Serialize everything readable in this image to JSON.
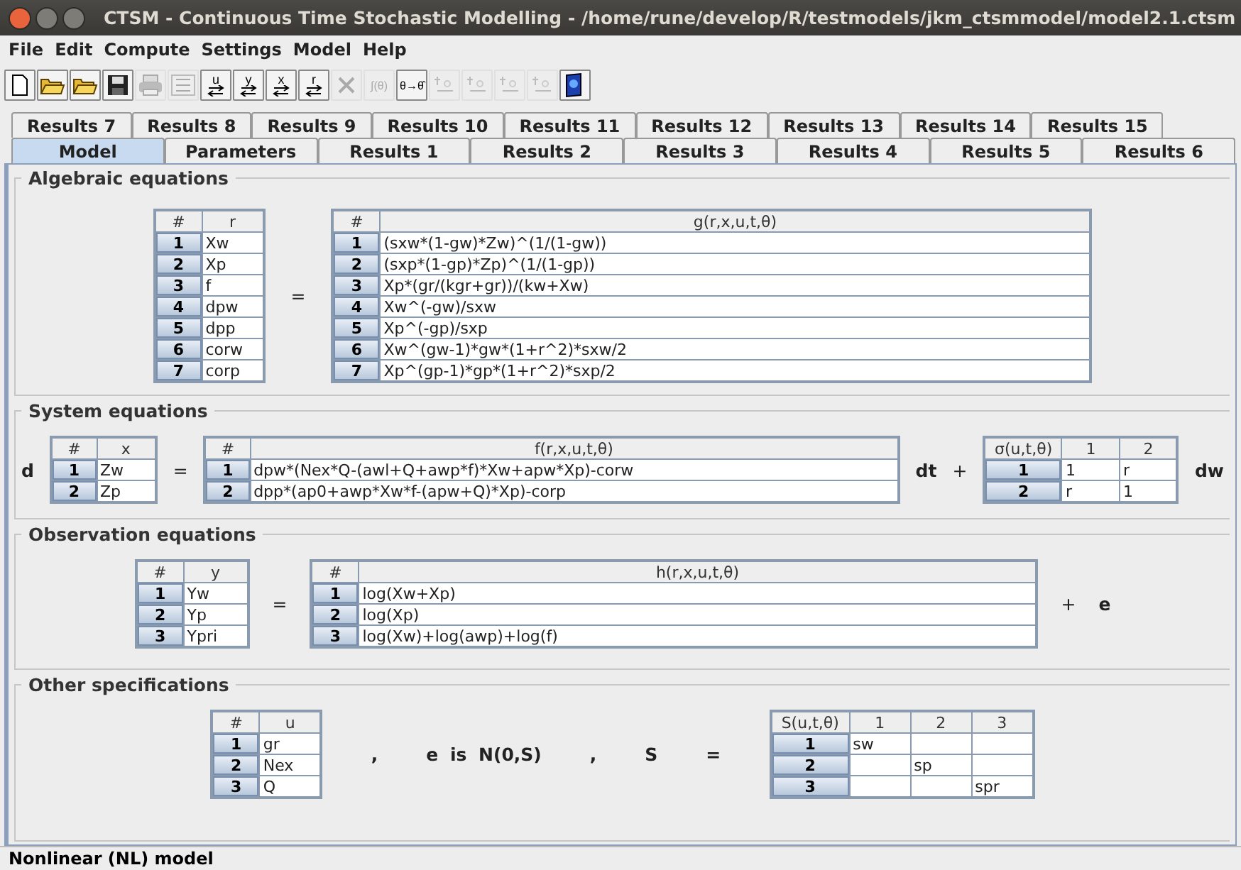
{
  "window": {
    "title": "CTSM - Continuous Time Stochastic Modelling - /home/rune/develop/R/testmodels/jkm_ctsmmodel/model2.1.ctsm"
  },
  "menu": [
    "File",
    "Edit",
    "Compute",
    "Settings",
    "Model",
    "Help"
  ],
  "toolbar": [
    {
      "kind": "new",
      "disabled": false
    },
    {
      "kind": "open",
      "disabled": false
    },
    {
      "kind": "open",
      "disabled": false
    },
    {
      "kind": "save",
      "disabled": false
    },
    {
      "kind": "print",
      "disabled": true
    },
    {
      "kind": "export",
      "disabled": true
    },
    {
      "kind": "swap",
      "label": "u",
      "disabled": false
    },
    {
      "kind": "swap",
      "label": "y",
      "disabled": false
    },
    {
      "kind": "swap",
      "label": "x",
      "disabled": false
    },
    {
      "kind": "swap",
      "label": "r",
      "disabled": false
    },
    {
      "kind": "delete",
      "disabled": true
    },
    {
      "kind": "text",
      "label": "∫(θ)",
      "disabled": true
    },
    {
      "kind": "text",
      "label": "θ→θ̂",
      "disabled": false
    },
    {
      "kind": "fit",
      "disabled": true
    },
    {
      "kind": "fit",
      "disabled": true
    },
    {
      "kind": "fit",
      "disabled": true
    },
    {
      "kind": "fit",
      "disabled": true
    },
    {
      "kind": "help",
      "disabled": false
    }
  ],
  "tabs_back": [
    {
      "label": "Results 7",
      "selected": false
    },
    {
      "label": "Results 8",
      "selected": false
    },
    {
      "label": "Results 9",
      "selected": false
    },
    {
      "label": "Results 10",
      "selected": false
    },
    {
      "label": "Results 11",
      "selected": false
    },
    {
      "label": "Results 12",
      "selected": false
    },
    {
      "label": "Results 13",
      "selected": false
    },
    {
      "label": "Results 14",
      "selected": false
    },
    {
      "label": "Results 15",
      "selected": false
    }
  ],
  "tabs_front": [
    {
      "label": "Model",
      "selected": true
    },
    {
      "label": "Parameters",
      "selected": false
    },
    {
      "label": "Results 1",
      "selected": false
    },
    {
      "label": "Results 2",
      "selected": false
    },
    {
      "label": "Results 3",
      "selected": false
    },
    {
      "label": "Results 4",
      "selected": false
    },
    {
      "label": "Results 5",
      "selected": false
    },
    {
      "label": "Results 6",
      "selected": false
    }
  ],
  "sections": [
    {
      "title": "Algebraic equations",
      "parts": [
        {
          "kind": "table",
          "columns": [
            "#",
            "r"
          ],
          "rows": [
            {
              "cells": [
                "1",
                "Xw"
              ]
            },
            {
              "cells": [
                "2",
                "Xp"
              ]
            },
            {
              "cells": [
                "3",
                "f"
              ]
            },
            {
              "cells": [
                "4",
                "dpw"
              ]
            },
            {
              "cells": [
                "5",
                "dpp"
              ]
            },
            {
              "cells": [
                "6",
                "corw"
              ]
            },
            {
              "cells": [
                "7",
                "corp"
              ]
            }
          ]
        },
        {
          "kind": "text",
          "text": "=",
          "bold": false
        },
        {
          "kind": "table",
          "columns": [
            "#",
            "g(r,x,u,t,θ)"
          ],
          "rows": [
            {
              "cells": [
                "1",
                "(sxw*(1-gw)*Zw)^(1/(1-gw))"
              ]
            },
            {
              "cells": [
                "2",
                "(sxp*(1-gp)*Zp)^(1/(1-gp))"
              ]
            },
            {
              "cells": [
                "3",
                "Xp*(gr/(kgr+gr))/(kw+Xw)"
              ]
            },
            {
              "cells": [
                "4",
                "Xw^(-gw)/sxw"
              ]
            },
            {
              "cells": [
                "5",
                "Xp^(-gp)/sxp"
              ]
            },
            {
              "cells": [
                "6",
                "Xw^(gw-1)*gw*(1+r^2)*sxw/2"
              ]
            },
            {
              "cells": [
                "7",
                "Xp^(gp-1)*gp*(1+r^2)*sxp/2"
              ]
            }
          ]
        }
      ]
    },
    {
      "title": "System equations",
      "parts": [
        {
          "kind": "text",
          "text": "d",
          "bold": true
        },
        {
          "kind": "table",
          "columns": [
            "#",
            "x"
          ],
          "rows": [
            {
              "cells": [
                "1",
                "Zw"
              ]
            },
            {
              "cells": [
                "2",
                "Zp"
              ]
            }
          ]
        },
        {
          "kind": "text",
          "text": "=",
          "bold": false
        },
        {
          "kind": "table",
          "columns": [
            "#",
            "f(r,x,u,t,θ)"
          ],
          "rows": [
            {
              "cells": [
                "1",
                "dpw*(Nex*Q-(awl+Q+awp*f)*Xw+apw*Xp)-corw"
              ]
            },
            {
              "cells": [
                "2",
                "dpp*(ap0+awp*Xw*f-(apw+Q)*Xp)-corp"
              ]
            }
          ]
        },
        {
          "kind": "text",
          "text": "dt",
          "bold": true
        },
        {
          "kind": "text",
          "text": "+",
          "bold": false
        },
        {
          "kind": "table",
          "columns": [
            "σ(u,t,θ)",
            "1",
            "2"
          ],
          "rows": [
            {
              "cells": [
                "1",
                "1",
                "r"
              ]
            },
            {
              "cells": [
                "2",
                "r",
                "1"
              ]
            }
          ]
        },
        {
          "kind": "text",
          "text": "dw",
          "bold": true
        }
      ]
    },
    {
      "title": "Observation equations",
      "parts": [
        {
          "kind": "table",
          "columns": [
            "#",
            "y"
          ],
          "rows": [
            {
              "cells": [
                "1",
                "Yw"
              ]
            },
            {
              "cells": [
                "2",
                "Yp"
              ]
            },
            {
              "cells": [
                "3",
                "Ypri"
              ]
            }
          ]
        },
        {
          "kind": "text",
          "text": "=",
          "bold": false
        },
        {
          "kind": "table",
          "columns": [
            "#",
            "h(r,x,u,t,θ)"
          ],
          "rows": [
            {
              "cells": [
                "1",
                "log(Xw+Xp)"
              ]
            },
            {
              "cells": [
                "2",
                "log(Xp)"
              ]
            },
            {
              "cells": [
                "3",
                "log(Xw)+log(awp)+log(f)"
              ]
            }
          ]
        },
        {
          "kind": "text",
          "text": "+",
          "bold": false
        },
        {
          "kind": "text",
          "text": "e",
          "bold": true
        }
      ]
    },
    {
      "title": "Other specifications",
      "parts": [
        {
          "kind": "table",
          "columns": [
            "#",
            "u"
          ],
          "rows": [
            {
              "cells": [
                "1",
                "gr"
              ]
            },
            {
              "cells": [
                "2",
                "Nex"
              ]
            },
            {
              "cells": [
                "3",
                "Q"
              ]
            }
          ]
        },
        {
          "kind": "text",
          "text": ",",
          "bold": true
        },
        {
          "kind": "text",
          "text": "e is N(0,S)",
          "bold": true
        },
        {
          "kind": "text",
          "text": ",",
          "bold": true
        },
        {
          "kind": "text",
          "text": "S",
          "bold": true
        },
        {
          "kind": "text",
          "text": "=",
          "bold": true
        },
        {
          "kind": "table",
          "columns": [
            "S(u,t,θ)",
            "1",
            "2",
            "3"
          ],
          "rows": [
            {
              "cells": [
                "1",
                "sw",
                "",
                ""
              ]
            },
            {
              "cells": [
                "2",
                "",
                "sp",
                ""
              ]
            },
            {
              "cells": [
                "3",
                "",
                "",
                "spr"
              ]
            }
          ]
        }
      ]
    }
  ],
  "status": "Nonlinear (NL) model"
}
